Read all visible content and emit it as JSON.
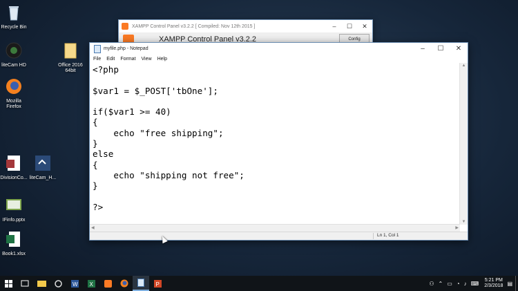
{
  "desktop": {
    "icons": [
      {
        "label": "Recycle Bin",
        "icon": "recycle-bin-icon"
      },
      {
        "label": "liteCam HD",
        "icon": "camera-icon"
      },
      {
        "label": "Mozilla Firefox",
        "icon": "firefox-icon"
      },
      {
        "label": "DivisionCo...",
        "icon": "access-file-icon"
      },
      {
        "label": "liteCam_H...",
        "icon": "shortcut-icon"
      },
      {
        "label": "IFinfo.pptx",
        "icon": "powerpoint-file-icon"
      },
      {
        "label": "Book1.xlsx",
        "icon": "excel-file-icon"
      },
      {
        "label": "Office 2016 64bit",
        "icon": "folder-icon"
      }
    ]
  },
  "xampp": {
    "title": "XAMPP Control Panel v3.2.2  [ Compiled: Nov 12th 2015 ]",
    "header": "XAMPP Control Panel v3.2.2",
    "config_label": "Config"
  },
  "notepad": {
    "title": "myfile.php - Notepad",
    "menu": [
      "File",
      "Edit",
      "Format",
      "View",
      "Help"
    ],
    "content": "<?php\n\n$var1 = $_POST['tbOne'];\n\nif($var1 >= 40)\n{\n    echo \"free shipping\";\n}\nelse\n{\n    echo \"shipping not free\";\n}\n\n?>",
    "status": "Ln 1, Col 1"
  },
  "taskbar": {
    "clock_time": "5:21 PM",
    "clock_date": "2/3/2018"
  },
  "colors": {
    "desktop_bg": "#16263a",
    "taskbar_bg": "#101418",
    "xampp_accent": "#fb7a24"
  }
}
